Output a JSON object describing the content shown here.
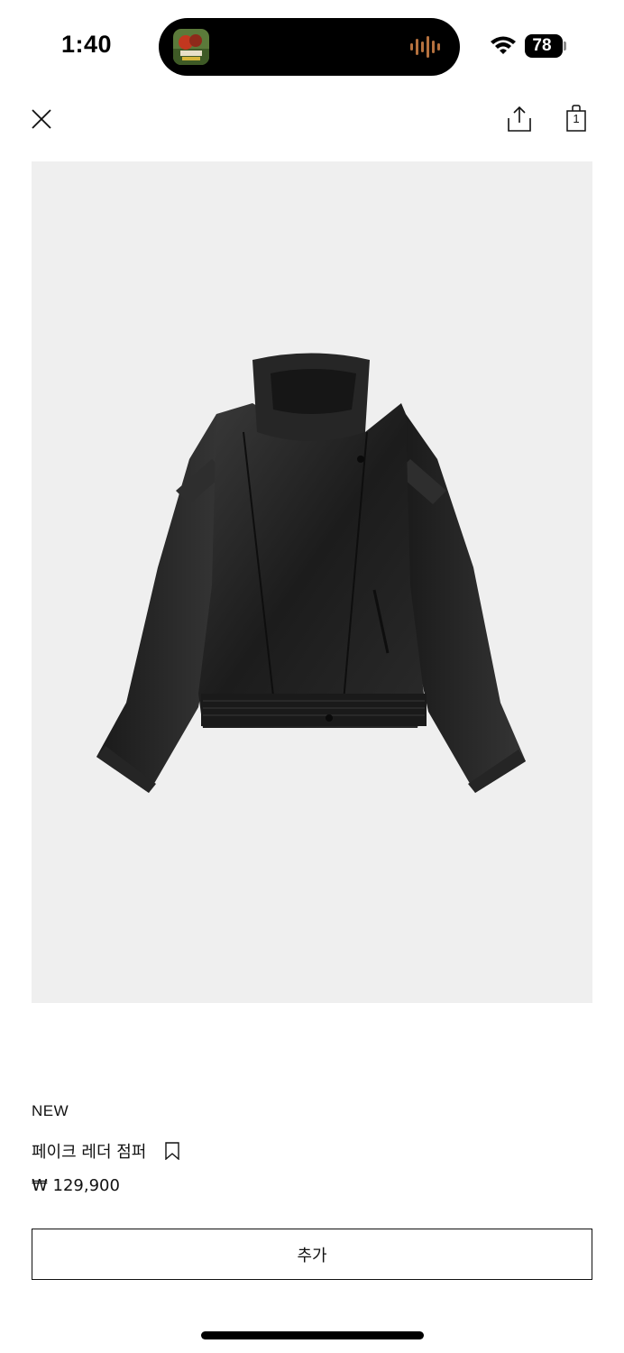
{
  "status_bar": {
    "time": "1:40",
    "battery_level": "78",
    "icons": [
      "album-art-icon",
      "waveform-icon",
      "wifi-icon",
      "battery-icon"
    ]
  },
  "toolbar": {
    "icons": [
      "close-icon",
      "share-icon",
      "shopping-bag-icon"
    ],
    "bag_count": "1"
  },
  "product": {
    "image_icon": "leather-jacket-image",
    "badge": "NEW",
    "name": "페이크 레더 점퍼",
    "bookmark_icon": "bookmark-icon",
    "price": "₩ 129,900"
  },
  "actions": {
    "add_label": "추가"
  },
  "colors": {
    "background": "#ffffff",
    "image_background": "#efefef",
    "text": "#111111",
    "accent_waveform": "#b5713e"
  }
}
